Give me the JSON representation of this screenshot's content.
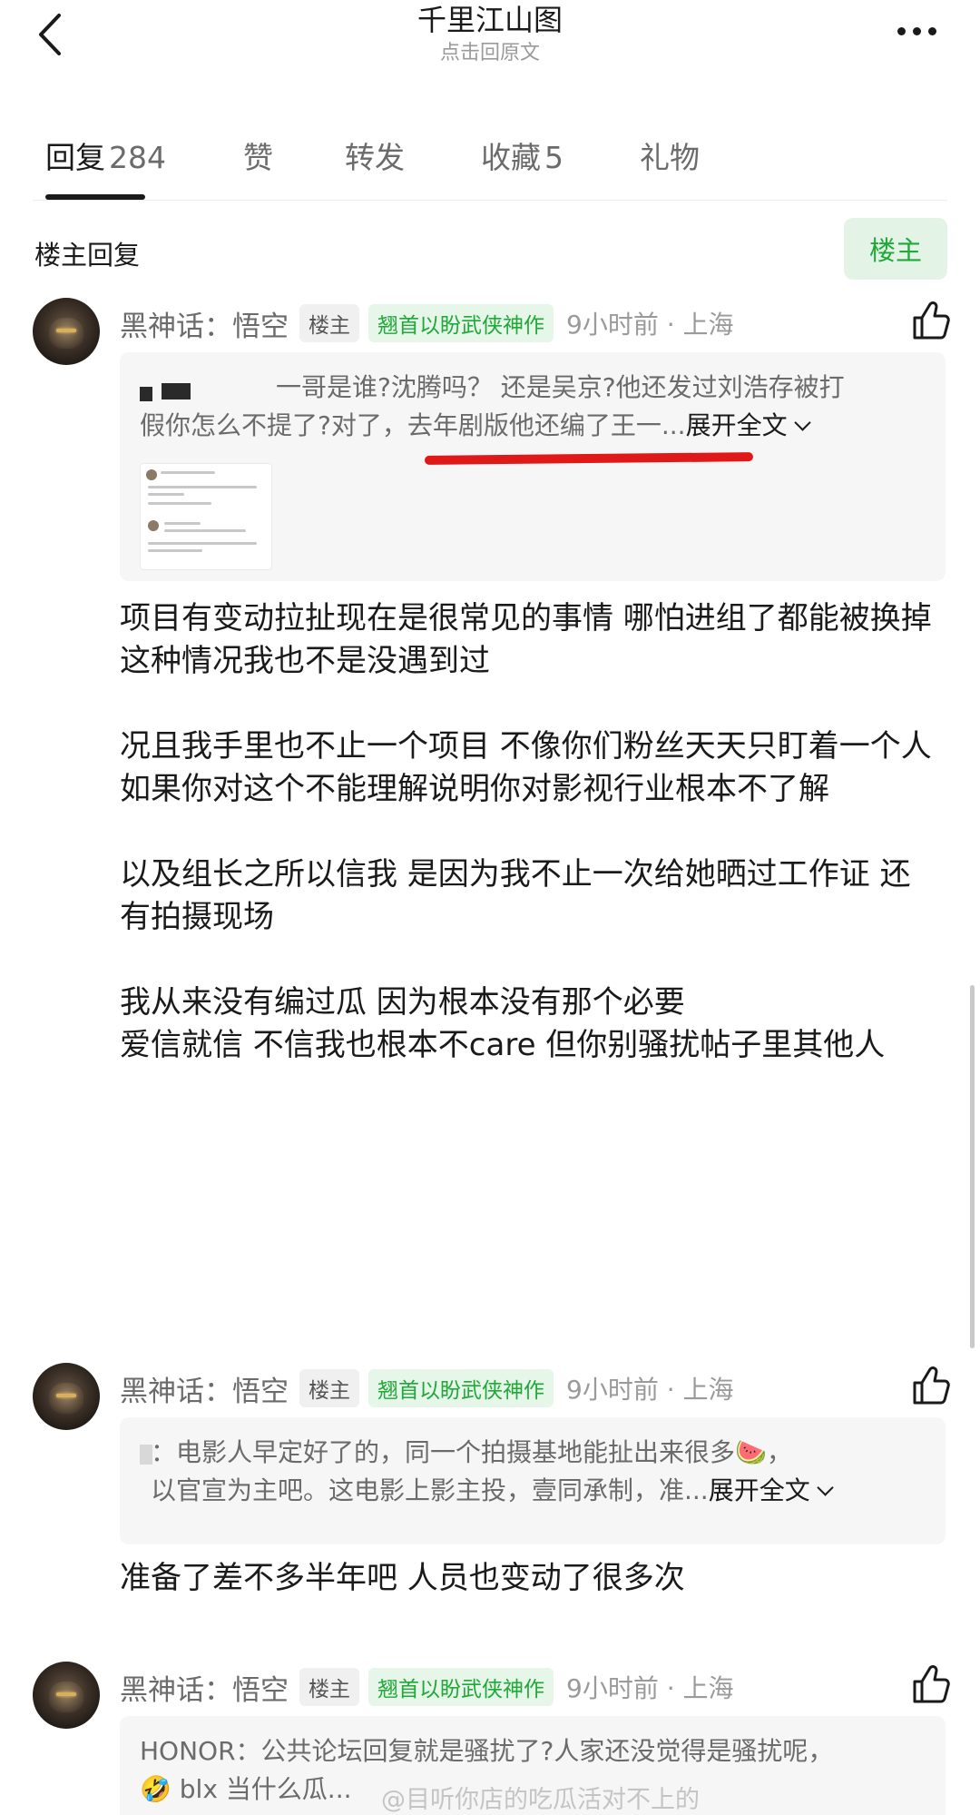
{
  "header": {
    "title": "千里江山图",
    "subtitle": "点击回原文"
  },
  "tabs": [
    {
      "label": "回复",
      "count": "284"
    },
    {
      "label": "赞",
      "count": ""
    },
    {
      "label": "转发",
      "count": ""
    },
    {
      "label": "收藏",
      "count": "5"
    },
    {
      "label": "礼物",
      "count": ""
    }
  ],
  "section": {
    "title": "楼主回复",
    "filter_label": "楼主"
  },
  "comments": [
    {
      "author": "黑神话：悟空",
      "host_badge": "楼主",
      "title_badge": "翘首以盼武侠神作",
      "time": "9小时前 · 上海",
      "quote_line1": "一哥是谁?沈腾吗？ 还是吴京?他还发过刘浩存被打",
      "quote_line2": "假你怎么不提了?对了，去年剧版他还编了王一...",
      "expand_label": "展开全文",
      "body": [
        "项目有变动拉扯现在是很常见的事情   哪怕进组了都能被换掉 这种情况我也不是没遇到过",
        "况且我手里也不止一个项目 不像你们粉丝天天只盯着一个人",
        "如果你对这个不能理解说明你对影视行业根本不了解",
        "以及组长之所以信我 是因为我不止一次给她晒过工作证 还有拍摄现场",
        "我从来没有编过瓜 因为根本没有那个必要",
        "爱信就信 不信我也根本不care 但你别骚扰帖子里其他人"
      ]
    },
    {
      "author": "黑神话：悟空",
      "host_badge": "楼主",
      "title_badge": "翘首以盼武侠神作",
      "time": "9小时前 · 上海",
      "quote_line1": "：电影人早定好了的，同一个拍摄基地能扯出来很多🍉，",
      "quote_line2": "以官宣为主吧。这电影上影主投，壹同承制，准...",
      "expand_label": "展开全文",
      "body": [
        "准备了差不多半年吧 人员也变动了很多次"
      ]
    },
    {
      "author": "黑神话：悟空",
      "host_badge": "楼主",
      "title_badge": "翘首以盼武侠神作",
      "time": "9小时前 · 上海",
      "quote_line1": "HONOR：公共论坛回复就是骚扰了?人家还没觉得是骚扰呢，",
      "quote_line2": "🤣 blx 当什么瓜..."
    }
  ],
  "watermark": "@目听你店的吃瓜活对不上的",
  "icons": {
    "back": "chevron-left-icon",
    "more": "more-dots-icon",
    "like": "thumbs-up-icon"
  },
  "colors": {
    "accent_green": "#20a838",
    "green_bg": "#e3f4e6",
    "annotation_red": "#e01818"
  }
}
